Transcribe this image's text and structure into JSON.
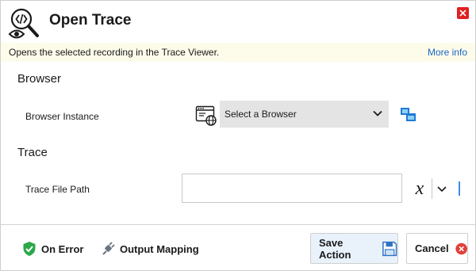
{
  "header": {
    "title": "Open Trace",
    "app_icon": "eye-magnifier-code-icon",
    "close_icon": "close-icon"
  },
  "info": {
    "description": "Opens the selected recording in the Trace Viewer.",
    "more_info": "More info"
  },
  "browser_section": {
    "title": "Browser",
    "instance_label": "Browser Instance",
    "select_value": "Select a Browser",
    "icon": "browser-window-icon",
    "extra_icon": "windows-icon"
  },
  "trace_section": {
    "title": "Trace",
    "path_label": "Trace File Path",
    "path_value": "",
    "variable_symbol": "x"
  },
  "footer": {
    "on_error": "On Error",
    "output_mapping": "Output Mapping",
    "save": "Save Action",
    "cancel": "Cancel"
  },
  "colors": {
    "close": "#e02020",
    "link": "#1a66c9",
    "info_bg": "#fdfbea",
    "save_bg": "#e9f1fb",
    "shield": "#2aa84a"
  }
}
